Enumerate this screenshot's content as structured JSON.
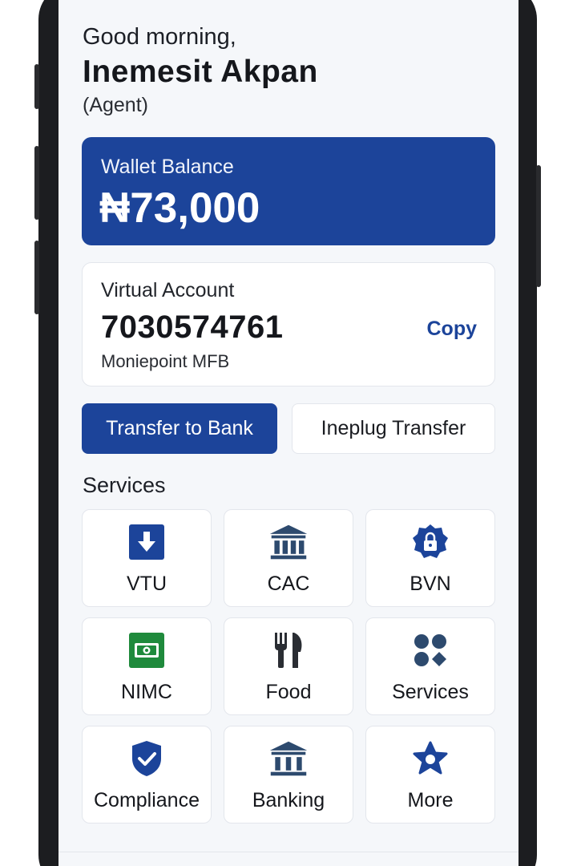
{
  "header": {
    "greeting": "Good morning,",
    "name": "Inemesit Akpan",
    "role": "(Agent)"
  },
  "wallet": {
    "label": "Wallet Balance",
    "amount": "₦73,000"
  },
  "virtual_account": {
    "label": "Virtual Account",
    "number": "7030574761",
    "bank": "Moniepoint MFB",
    "copy_label": "Copy"
  },
  "actions": {
    "transfer_bank": "Transfer to Bank",
    "ineplug_transfer": "Ineplug Transfer"
  },
  "services": {
    "title": "Services",
    "items": [
      {
        "label": "VTU",
        "icon": "download-icon"
      },
      {
        "label": "CAC",
        "icon": "bank-icon"
      },
      {
        "label": "BVN",
        "icon": "lock-badge-icon"
      },
      {
        "label": "NIMC",
        "icon": "id-card-icon"
      },
      {
        "label": "Food",
        "icon": "fork-knife-icon"
      },
      {
        "label": "Services",
        "icon": "grid-icon"
      },
      {
        "label": "Compliance",
        "icon": "shield-check-icon"
      },
      {
        "label": "Banking",
        "icon": "bank-icon"
      },
      {
        "label": "More",
        "icon": "star-icon"
      }
    ]
  },
  "colors": {
    "brand": "#1c449a",
    "icon_dark": "#2d4a6e",
    "nimc_green": "#1f8a3c"
  }
}
